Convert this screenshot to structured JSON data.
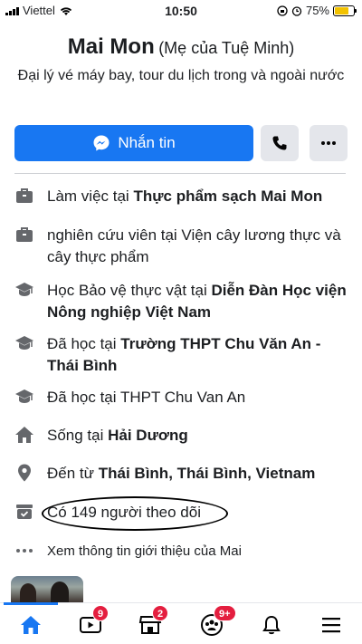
{
  "status_bar": {
    "carrier": "Viettel",
    "time": "10:50",
    "battery": "75%"
  },
  "profile": {
    "name": "Mai Mon",
    "alternate_name": "(Mẹ của Tuệ Minh)",
    "bio": "Đại lý vé máy bay, tour du lịch trong và ngoài nước"
  },
  "actions": {
    "message_label": "Nhắn tin"
  },
  "details": [
    {
      "icon": "briefcase-icon",
      "prefix": "Làm việc tại ",
      "bold": "Thực phẩm sạch Mai Mon"
    },
    {
      "icon": "briefcase-icon",
      "prefix": "nghiên cứu viên tại Viện cây lương thực và cây thực phẩm",
      "bold": ""
    },
    {
      "icon": "graduation-cap-icon",
      "prefix": "Học Bảo vệ thực vật tại ",
      "bold": "Diễn Đàn Học viện Nông nghiệp Việt Nam"
    },
    {
      "icon": "graduation-cap-icon",
      "prefix": "Đã học tại ",
      "bold": "Trường THPT Chu Văn An - Thái Bình"
    },
    {
      "icon": "graduation-cap-icon",
      "prefix": "Đã học tại THPT Chu Van An",
      "bold": ""
    },
    {
      "icon": "home-icon",
      "prefix": "Sống tại ",
      "bold": "Hải Dương"
    },
    {
      "icon": "location-pin-icon",
      "prefix": "Đến từ ",
      "bold": "Thái Bình, Thái Bình, Vietnam"
    },
    {
      "icon": "followers-icon",
      "prefix": "Có 149 người theo dõi",
      "bold": ""
    },
    {
      "icon": "ellipsis-icon",
      "prefix": "Xem thông tin giới thiệu của Mai",
      "bold": ""
    }
  ],
  "bottom_nav": {
    "video_badge": "9",
    "marketplace_badge": "2",
    "groups_badge": "9+"
  },
  "colors": {
    "accent": "#1877f2",
    "badge": "#e41e3f"
  }
}
